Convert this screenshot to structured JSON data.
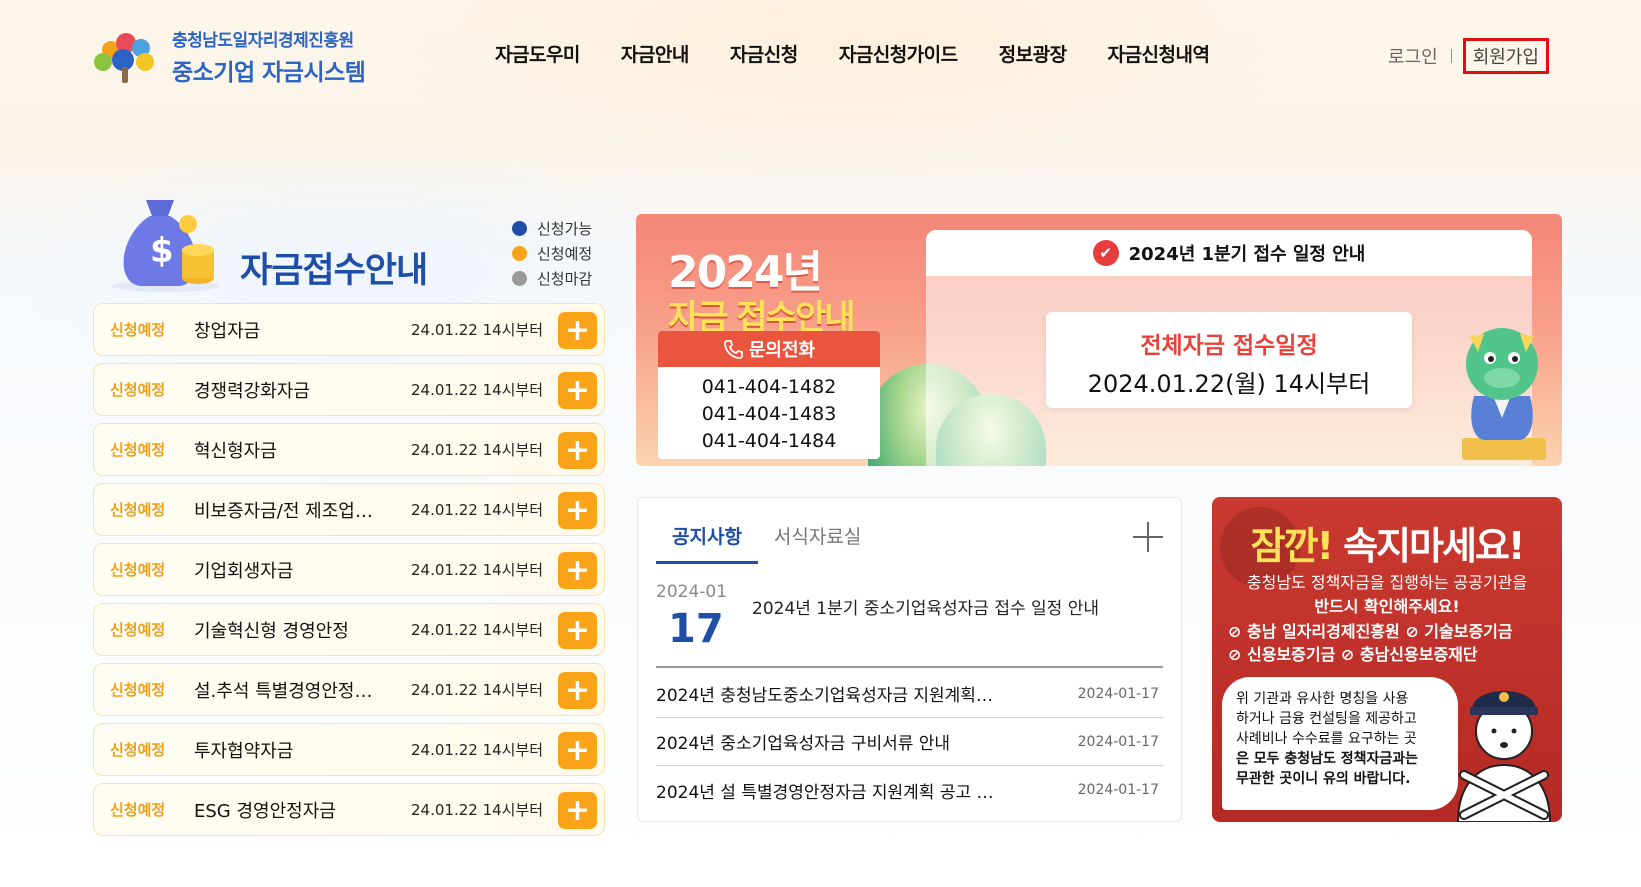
{
  "header": {
    "logo_line1": "충청남도일자리경제진흥원",
    "logo_line2": "중소기업 자금시스템",
    "nav": [
      "자금도우미",
      "자금안내",
      "자금신청",
      "자금신청가이드",
      "정보광장",
      "자금신청내역"
    ],
    "login": "로그인",
    "join": "회원가입"
  },
  "fund": {
    "title": "자금접수안내",
    "legend": [
      {
        "label": "신청가능",
        "color": "#1e4ea8"
      },
      {
        "label": "신청예정",
        "color": "#f8a318"
      },
      {
        "label": "신청마감",
        "color": "#9a9a9a"
      }
    ],
    "items": [
      {
        "status": "신청예정",
        "name": "창업자금",
        "date": "24.01.22 14시부터"
      },
      {
        "status": "신청예정",
        "name": "경쟁력강화자금",
        "date": "24.01.22 14시부터"
      },
      {
        "status": "신청예정",
        "name": "혁신형자금",
        "date": "24.01.22 14시부터"
      },
      {
        "status": "신청예정",
        "name": "비보증자금/전 제조업…",
        "date": "24.01.22 14시부터"
      },
      {
        "status": "신청예정",
        "name": "기업회생자금",
        "date": "24.01.22 14시부터"
      },
      {
        "status": "신청예정",
        "name": "기술혁신형 경영안정",
        "date": "24.01.22 14시부터"
      },
      {
        "status": "신청예정",
        "name": "설.추석 특별경영안정…",
        "date": "24.01.22 14시부터"
      },
      {
        "status": "신청예정",
        "name": "투자협약자금",
        "date": "24.01.22 14시부터"
      },
      {
        "status": "신청예정",
        "name": "ESG 경영안정자금",
        "date": "24.01.22 14시부터"
      }
    ],
    "plus": "+"
  },
  "banner": {
    "year": "2024년",
    "subtitle": "자금 접수안내",
    "phone_title": "문의전화",
    "phones": [
      "041-404-1482",
      "041-404-1483",
      "041-404-1484"
    ],
    "schedule_title": "2024년 1분기 접수 일정 안내",
    "schedule_label": "전체자금 접수일정",
    "schedule_value": "2024.01.22(월) 14시부터"
  },
  "notice": {
    "tabs": [
      "공지사항",
      "서식자료실"
    ],
    "featured": {
      "ym": "2024-01",
      "day": "17",
      "title": "2024년 1분기 중소기업육성자금 접수 일정 안내"
    },
    "rows": [
      {
        "title": "2024년 충청남도중소기업육성자금 지원계획…",
        "date": "2024-01-17"
      },
      {
        "title": "2024년 중소기업육성자금 구비서류 안내",
        "date": "2024-01-17"
      },
      {
        "title": "2024년 설 특별경영안정자금 지원계획 공고 …",
        "date": "2024-01-17"
      }
    ]
  },
  "warning": {
    "title_a": "잠깐!",
    "title_b": "속지마세요!",
    "sub1": "충청남도 정책자금을 집행하는 공공기관을",
    "sub2": "반드시 확인해주세요!",
    "org_line1": "⊘ 충남 일자리경제진흥원 ⊘ 기술보증기금",
    "org_line2": "⊘ 신용보증기금 ⊘ 충남신용보증재단",
    "bubble": [
      "위 기관과 유사한 명칭을 사용",
      "하거나 금융 컨설팅을 제공하고",
      "사례비나 수수료를 요구하는 곳",
      "은 모두 충청남도 정책자금과는",
      "무관한 곳이니 유의 바랍니다."
    ]
  }
}
